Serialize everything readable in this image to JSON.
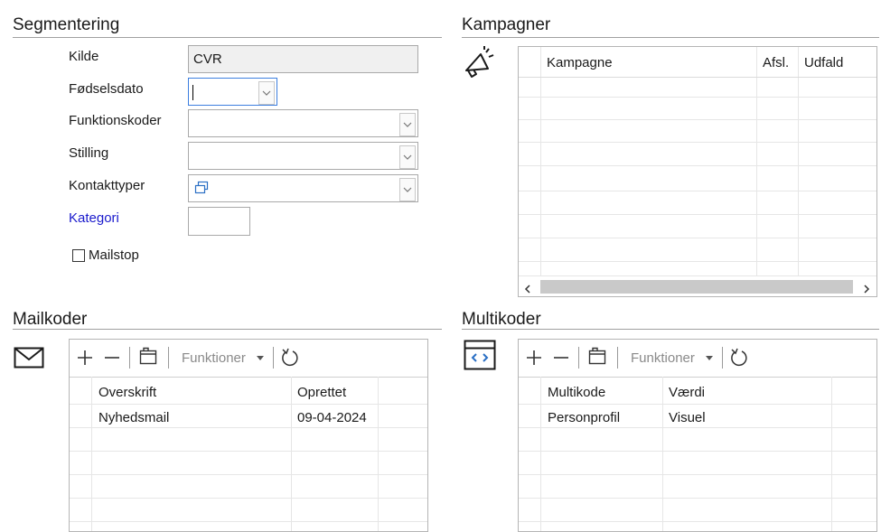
{
  "segmentering": {
    "title": "Segmentering",
    "fields": {
      "kilde": {
        "label": "Kilde",
        "value": "CVR"
      },
      "foedselsdato": {
        "label": "Fødselsdato",
        "value": ""
      },
      "funktionskoder": {
        "label": "Funktionskoder",
        "value": ""
      },
      "stilling": {
        "label": "Stilling",
        "value": ""
      },
      "kontakttyper": {
        "label": "Kontakttyper",
        "value": ""
      },
      "kategori": {
        "label": "Kategori",
        "value": ""
      }
    },
    "mailstop": {
      "label": "Mailstop",
      "checked": false
    }
  },
  "kampagner": {
    "title": "Kampagner",
    "icon": "megaphone-icon",
    "columns": [
      "Kampagne",
      "Afsl.",
      "Udfald"
    ],
    "rows": []
  },
  "mailkoder": {
    "title": "Mailkoder",
    "icon": "envelope-icon",
    "toolbar": {
      "functions_label": "Funktioner"
    },
    "columns": [
      "Overskrift",
      "Oprettet"
    ],
    "rows": [
      {
        "overskrift": "Nyhedsmail",
        "oprettet": "09-04-2024"
      }
    ]
  },
  "multikoder": {
    "title": "Multikoder",
    "icon": "code-window-icon",
    "toolbar": {
      "functions_label": "Funktioner"
    },
    "columns": [
      "Multikode",
      "Værdi"
    ],
    "rows": [
      {
        "multikode": "Personprofil",
        "vaerdi": "Visuel"
      }
    ]
  },
  "colors": {
    "link": "#1a1acc",
    "focus_border": "#3d7fe0",
    "readonly_bg": "#f0f0f0",
    "icon_blue": "#2a6fc4"
  }
}
